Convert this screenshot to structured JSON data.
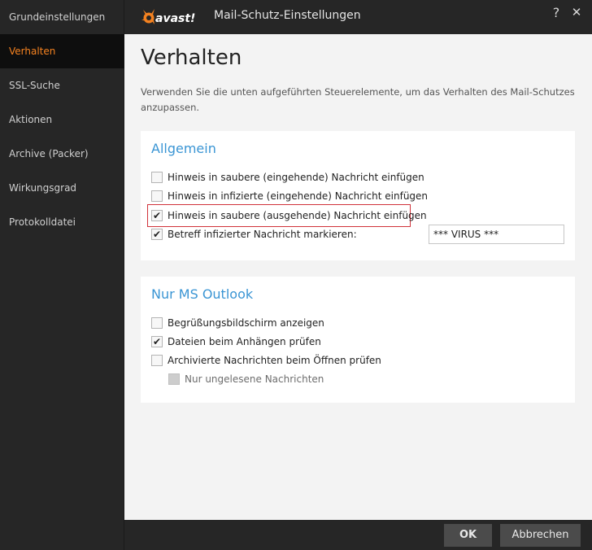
{
  "window": {
    "title": "Mail-Schutz-Einstellungen",
    "logo_text": "avast!",
    "help_label": "?",
    "close_label": "✕"
  },
  "sidebar": {
    "items": [
      {
        "label": "Grundeinstellungen",
        "active": false
      },
      {
        "label": "Verhalten",
        "active": true
      },
      {
        "label": "SSL-Suche",
        "active": false
      },
      {
        "label": "Aktionen",
        "active": false
      },
      {
        "label": "Archive (Packer)",
        "active": false
      },
      {
        "label": "Wirkungsgrad",
        "active": false
      },
      {
        "label": "Protokolldatei",
        "active": false
      }
    ]
  },
  "main": {
    "title": "Verhalten",
    "description": "Verwenden Sie die unten aufgeführten Steuerelemente, um das Verhalten des Mail-Schutzes anzupassen.",
    "general": {
      "title": "Allgemein",
      "options": [
        {
          "label": "Hinweis in saubere (eingehende) Nachricht einfügen",
          "checked": false
        },
        {
          "label": "Hinweis in infizierte (eingehende) Nachricht einfügen",
          "checked": false
        },
        {
          "label": "Hinweis in saubere (ausgehende) Nachricht einfügen",
          "checked": true
        },
        {
          "label": "Betreff infizierter Nachricht markieren:",
          "checked": true
        }
      ],
      "subject_tag_value": "*** VIRUS ***"
    },
    "outlook": {
      "title": "Nur MS Outlook",
      "options": [
        {
          "label": "Begrüßungsbildschirm anzeigen",
          "checked": false
        },
        {
          "label": "Dateien beim Anhängen prüfen",
          "checked": true
        },
        {
          "label": "Archivierte Nachrichten beim Öffnen prüfen",
          "checked": false
        },
        {
          "label": "Nur ungelesene Nachrichten",
          "checked": false,
          "disabled": true
        }
      ]
    }
  },
  "footer": {
    "ok_label": "OK",
    "cancel_label": "Abbrechen"
  },
  "colors": {
    "accent": "#f58220",
    "section_title": "#3a95d4",
    "highlight": "#d0323a"
  }
}
